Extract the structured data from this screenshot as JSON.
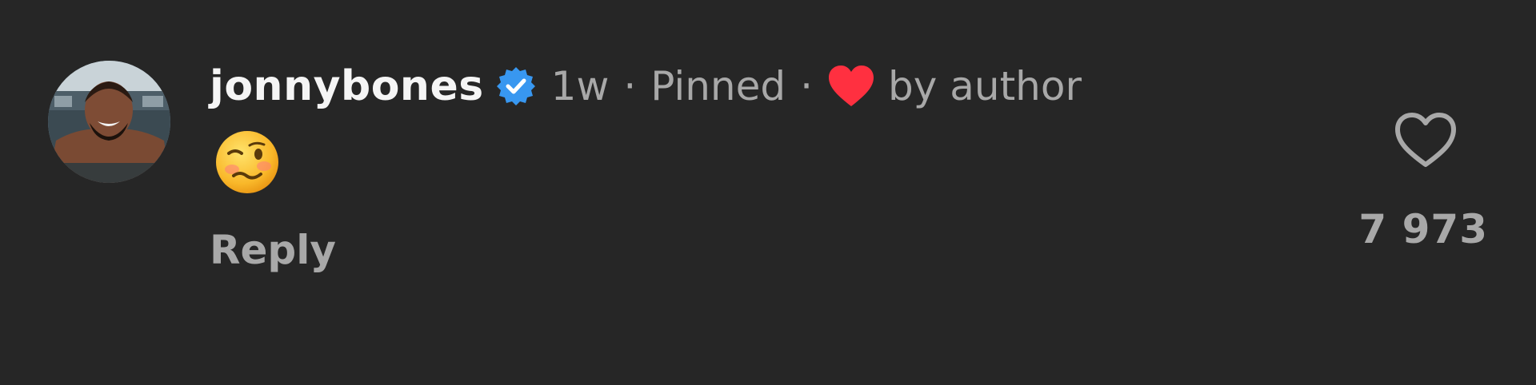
{
  "comment": {
    "username": "jonnybones",
    "verified_icon": "verified-badge-icon",
    "time_ago": "1w",
    "separator": "·",
    "pinned_label": "Pinned",
    "author_like_icon": "red-heart-icon",
    "author_like_label": "by author",
    "body_emoji": "🥴",
    "reply_label": "Reply",
    "like_icon": "heart-outline-icon",
    "like_count": "7 973"
  },
  "colors": {
    "background": "#262626",
    "primary_text": "#f5f5f5",
    "secondary_text": "#a8a8a8",
    "verified_blue": "#3897f0",
    "heart_red": "#ff3040"
  }
}
